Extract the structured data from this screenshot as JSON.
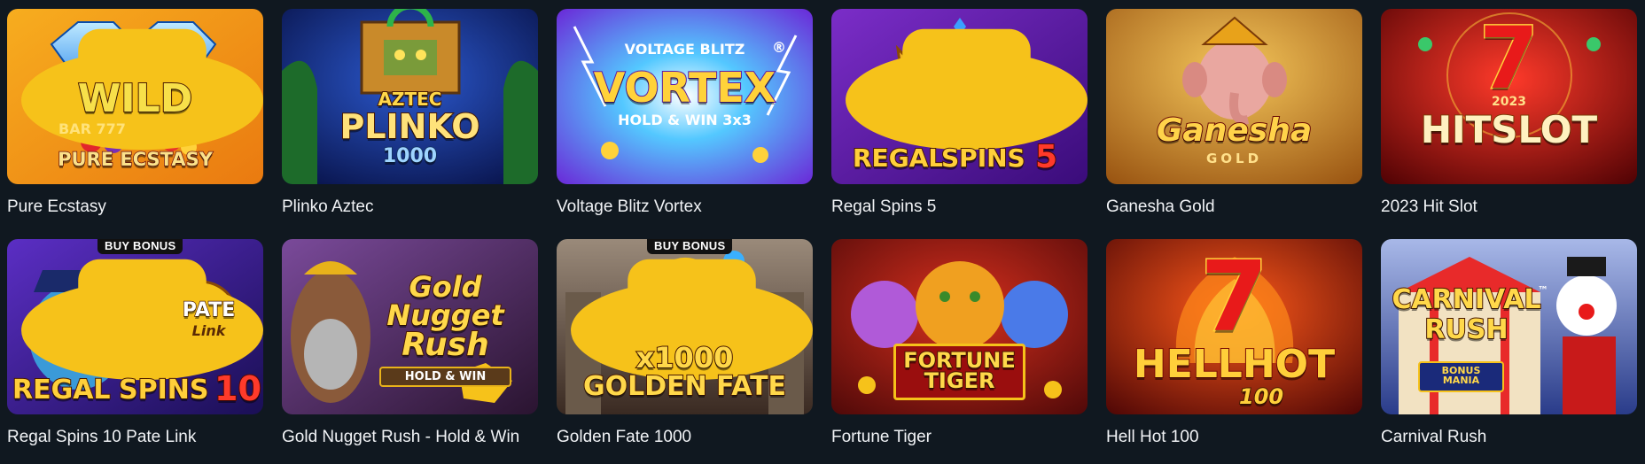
{
  "games": [
    {
      "title": "Pure Ecstasy",
      "logo": [
        "WILD",
        "PURE ECSTASY"
      ],
      "extra": "BAR 777",
      "colors": {
        "bg1": "#f6a21a",
        "bg2": "#e8730f"
      }
    },
    {
      "title": "Plinko Aztec",
      "logo": [
        "AZTEC",
        "PLINKO",
        "1000"
      ],
      "colors": {
        "bg1": "#1d3fa8",
        "bg2": "#0c1b5c"
      }
    },
    {
      "title": "Voltage Blitz Vortex",
      "logo": [
        "VOLTAGE BLITZ",
        "VORTEX",
        "HOLD & WIN 3x3"
      ],
      "extra": "®",
      "colors": {
        "bg1": "#7a3fe0",
        "bg2": "#1a63e8"
      }
    },
    {
      "title": "Regal Spins 5",
      "logo": [
        "REGAL",
        "SPINS",
        "5"
      ],
      "colors": {
        "bg1": "#6a1fb3",
        "bg2": "#3a0c7a"
      }
    },
    {
      "title": "Ganesha Gold",
      "logo": [
        "Ganesha",
        "GOLD"
      ],
      "colors": {
        "bg1": "#e0a22a",
        "bg2": "#8c4b10"
      }
    },
    {
      "title": "2023 Hit Slot",
      "logo": [
        "7",
        "2023",
        "HITSLOT"
      ],
      "colors": {
        "bg1": "#d4171a",
        "bg2": "#5e0407"
      }
    },
    {
      "title": "Regal Spins 10 Pate Link",
      "logo": [
        "PATE",
        "Link",
        "REGAL",
        "SPINS",
        "10"
      ],
      "badge": "BUY BONUS",
      "colors": {
        "bg1": "#5b2ec4",
        "bg2": "#1e1260"
      }
    },
    {
      "title": "Gold Nugget Rush - Hold & Win",
      "logo": [
        "Gold",
        "Nugget",
        "Rush",
        "HOLD & WIN"
      ],
      "colors": {
        "bg1": "#6a3b8a",
        "bg2": "#2c1636"
      }
    },
    {
      "title": "Golden Fate 1000",
      "logo": [
        "x1000",
        "GOLDEN FATE"
      ],
      "badge": "BUY BONUS",
      "colors": {
        "bg1": "#8a7a6a",
        "bg2": "#3a2a22"
      }
    },
    {
      "title": "Fortune Tiger",
      "logo": [
        "FORTUNE",
        "TIGER"
      ],
      "colors": {
        "bg1": "#c0201e",
        "bg2": "#5c0a0a"
      }
    },
    {
      "title": "Hell Hot 100",
      "logo": [
        "7",
        "HELLHOT",
        "100"
      ],
      "colors": {
        "bg1": "#d01a10",
        "bg2": "#5a0608"
      }
    },
    {
      "title": "Carnival Rush",
      "logo": [
        "CARNIVAL",
        "RUSH",
        "BONUS",
        "MANIA"
      ],
      "extra": "™",
      "colors": {
        "bg1": "#9aa9d8",
        "bg2": "#2a3c8a"
      }
    }
  ],
  "icons": {
    "corner": "hat-badge-icon"
  },
  "colors": {
    "page_bg": "#101820",
    "title_text": "#f1f3f6",
    "corner_yellow": "#f6c21a"
  }
}
